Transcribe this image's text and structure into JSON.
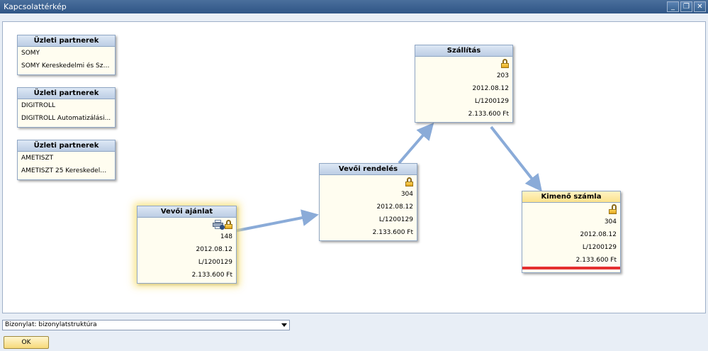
{
  "window": {
    "title": "Kapcsolattérkép",
    "controls": [
      "_",
      "❐",
      "✕"
    ]
  },
  "bp_cards": [
    {
      "title": "Üzleti partnerek",
      "code": "SOMY",
      "name": "SOMY Kereskedelmi és Szo..."
    },
    {
      "title": "Üzleti partnerek",
      "code": "DIGITROLL",
      "name": "DIGITROLL Automatizálási..."
    },
    {
      "title": "Üzleti partnerek",
      "code": "AMETISZT",
      "name": "AMETISZT 25 Kereskedelm..."
    }
  ],
  "docs": {
    "quote": {
      "title": "Vevői ajánlat",
      "number": "148",
      "date": "2012.08.12",
      "ref": "L/1200129",
      "amount": "2.133.600 Ft"
    },
    "order": {
      "title": "Vevői rendelés",
      "number": "304",
      "date": "2012.08.12",
      "ref": "L/1200129",
      "amount": "2.133.600 Ft"
    },
    "delivery": {
      "title": "Szállítás",
      "number": "203",
      "date": "2012.08.12",
      "ref": "L/1200129",
      "amount": "2.133.600 Ft"
    },
    "invoice": {
      "title": "Kimenő számla",
      "number": "304",
      "date": "2012.08.12",
      "ref": "L/1200129",
      "amount": "2.133.600 Ft"
    }
  },
  "footer": {
    "select_value": "Bizonylat: bizonylatstruktúra",
    "ok_label": "OK"
  },
  "colors": {
    "arrow": "#8aabd8",
    "invoice_status": "#e53030",
    "header_blue": "#bccde4",
    "header_yellow": "#fbe28c"
  },
  "icons": {
    "lock": "lock-icon",
    "open_lock": "unlock-icon",
    "printer": "printer-icon"
  }
}
